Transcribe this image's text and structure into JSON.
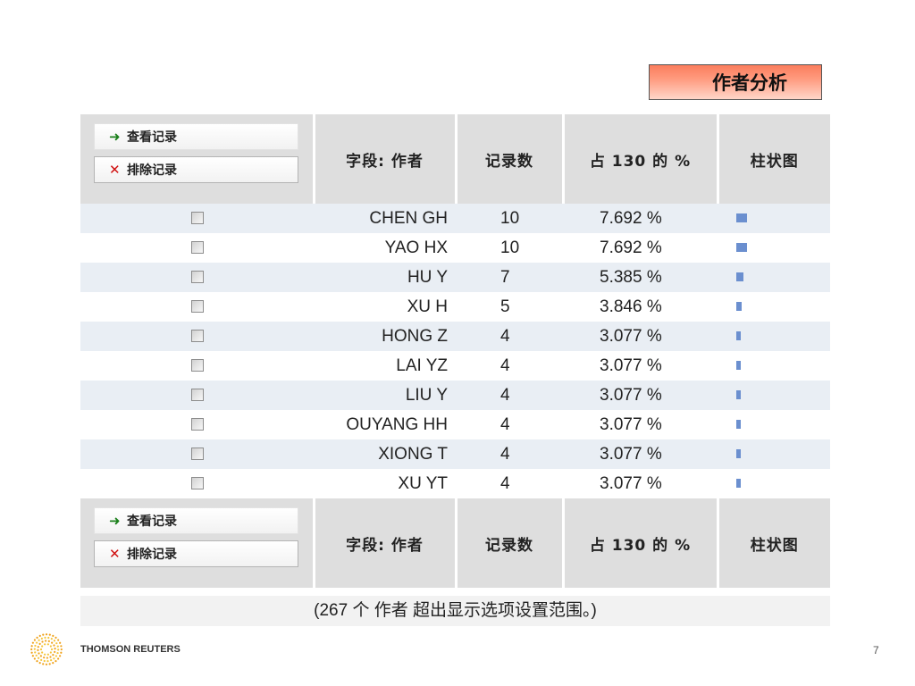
{
  "title": "作者分析",
  "buttons": {
    "view": "查看记录",
    "exclude": "排除记录"
  },
  "columns": {
    "field": "字段: 作者",
    "count": "记录数",
    "pct": "占 130 的 %",
    "bar": "柱状图"
  },
  "rows": [
    {
      "name": "CHEN GH",
      "count": "10",
      "pct": "7.692 %",
      "bar_value": 10
    },
    {
      "name": "YAO HX",
      "count": "10",
      "pct": "7.692 %",
      "bar_value": 10
    },
    {
      "name": "HU Y",
      "count": "7",
      "pct": "5.385 %",
      "bar_value": 7
    },
    {
      "name": "XU H",
      "count": "5",
      "pct": "3.846 %",
      "bar_value": 5
    },
    {
      "name": "HONG Z",
      "count": "4",
      "pct": "3.077 %",
      "bar_value": 4
    },
    {
      "name": "LAI YZ",
      "count": "4",
      "pct": "3.077 %",
      "bar_value": 4
    },
    {
      "name": "LIU Y",
      "count": "4",
      "pct": "3.077 %",
      "bar_value": 4
    },
    {
      "name": "OUYANG HH",
      "count": "4",
      "pct": "3.077 %",
      "bar_value": 4
    },
    {
      "name": "XIONG T",
      "count": "4",
      "pct": "3.077 %",
      "bar_value": 4
    },
    {
      "name": "XU YT",
      "count": "4",
      "pct": "3.077 %",
      "bar_value": 4
    }
  ],
  "note": "(267 个 作者 超出显示选项设置范围。)",
  "brand": "THOMSON REUTERS",
  "page_number": "7",
  "colors": {
    "bar": "#6b8fcf",
    "title_bg": "#fb7d5d",
    "row_alt": "#e9eef4",
    "header_bg": "#dedede"
  },
  "icons": {
    "view": "arrow-right-icon",
    "exclude": "cross-icon",
    "logo": "thomson-reuters-logo-icon"
  }
}
